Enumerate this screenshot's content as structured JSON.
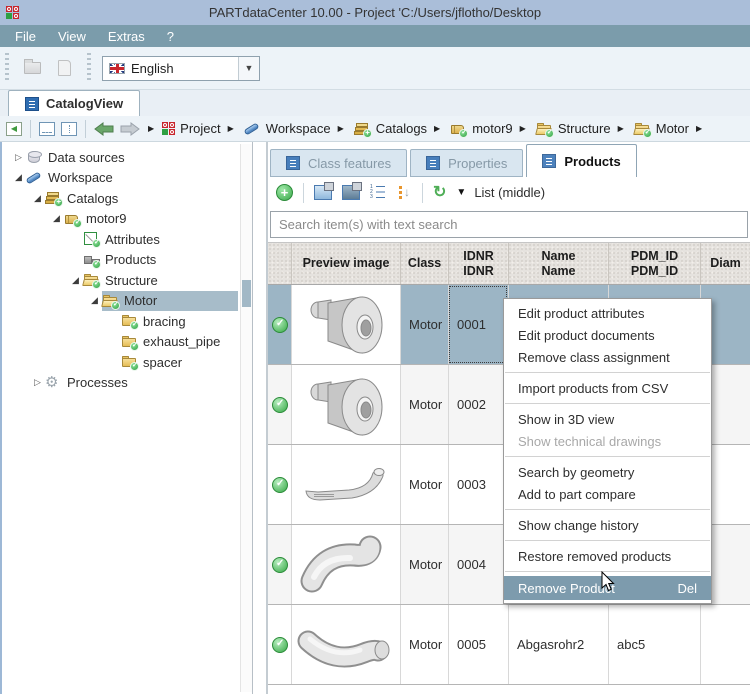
{
  "window": {
    "title": "PARTdataCenter 10.00 - Project 'C:/Users/jflotho/Desktop"
  },
  "menubar": {
    "items": [
      "File",
      "View",
      "Extras",
      "?"
    ]
  },
  "quick_toolbar": {
    "language_selector": {
      "value": "English",
      "flag": "uk-flag-icon"
    }
  },
  "view_tabs": {
    "catalog_view": "CatalogView"
  },
  "navbar": {
    "breadcrumb": [
      {
        "label": "Project",
        "icon": "project-logo-icon"
      },
      {
        "label": "Workspace",
        "icon": "workspace-icon"
      },
      {
        "label": "Catalogs",
        "icon": "catalogs-icon"
      },
      {
        "label": "motor9",
        "icon": "catalog-icon"
      },
      {
        "label": "Structure",
        "icon": "folder-open-icon"
      },
      {
        "label": "Motor",
        "icon": "folder-open-icon"
      }
    ]
  },
  "tree": {
    "items": [
      {
        "label": "Data sources",
        "icon": "database-icon",
        "state": "collapsed"
      },
      {
        "label": "Workspace",
        "icon": "workspace-icon",
        "state": "expanded"
      },
      {
        "label": "Catalogs",
        "icon": "catalogs-icon",
        "state": "expanded"
      },
      {
        "label": "motor9",
        "icon": "catalog-icon",
        "state": "expanded"
      },
      {
        "label": "Attributes",
        "icon": "attributes-icon",
        "state": "leaf"
      },
      {
        "label": "Products",
        "icon": "products-icon",
        "state": "leaf"
      },
      {
        "label": "Structure",
        "icon": "folder-open-icon",
        "state": "expanded"
      },
      {
        "label": "Motor",
        "icon": "folder-open-icon",
        "state": "expanded",
        "selected": true
      },
      {
        "label": "bracing",
        "icon": "folder-icon",
        "state": "leaf"
      },
      {
        "label": "exhaust_pipe",
        "icon": "folder-icon",
        "state": "leaf"
      },
      {
        "label": "spacer",
        "icon": "folder-icon",
        "state": "leaf"
      },
      {
        "label": "Processes",
        "icon": "gear-icon",
        "state": "collapsed"
      }
    ]
  },
  "panel": {
    "tabs": [
      {
        "label": "Class features",
        "active": false
      },
      {
        "label": "Properties",
        "active": false
      },
      {
        "label": "Products",
        "active": true
      }
    ],
    "toolbar": {
      "view_mode_label": "List (middle)"
    },
    "search": {
      "placeholder": "Search item(s) with text search"
    }
  },
  "table": {
    "columns": [
      {
        "line1": "",
        "line2": ""
      },
      {
        "line1": "Preview image",
        "line2": ""
      },
      {
        "line1": "Class",
        "line2": ""
      },
      {
        "line1": "IDNR",
        "line2": "IDNR"
      },
      {
        "line1": "Name",
        "line2": "Name"
      },
      {
        "line1": "PDM_ID",
        "line2": "PDM_ID"
      },
      {
        "line1": "",
        "line2": "Diam"
      }
    ],
    "rows": [
      {
        "status": "approved",
        "class": "Motor",
        "idnr": "0001",
        "name": "",
        "pdm_id": "",
        "preview": "motor-part"
      },
      {
        "status": "approved",
        "class": "Motor",
        "idnr": "0002",
        "name": "",
        "pdm_id": "",
        "preview": "motor-part"
      },
      {
        "status": "approved",
        "class": "Motor",
        "idnr": "0003",
        "name": "",
        "pdm_id": "",
        "preview": "curved-strap"
      },
      {
        "status": "approved",
        "class": "Motor",
        "idnr": "0004",
        "name": "",
        "pdm_id": "",
        "preview": "elbow-pipe"
      },
      {
        "status": "approved",
        "class": "Motor",
        "idnr": "0005",
        "name": "Abgasrohr2",
        "pdm_id": "abc5",
        "preview": "exhaust-pipe"
      }
    ]
  },
  "context_menu": {
    "items": [
      {
        "label": "Edit product attributes"
      },
      {
        "label": "Edit product documents"
      },
      {
        "label": "Remove class assignment"
      },
      {
        "label": "Import products from CSV"
      },
      {
        "label": "Show in 3D view"
      },
      {
        "label": "Show technical drawings",
        "disabled": true
      },
      {
        "label": "Search by geometry"
      },
      {
        "label": "Add to part compare"
      },
      {
        "label": "Show change history"
      },
      {
        "label": "Restore removed products"
      },
      {
        "label": "Remove Product",
        "shortcut": "Del",
        "highlighted": true
      }
    ]
  },
  "colors": {
    "titlebar": "#aabed9",
    "menubar": "#7b9cab",
    "row_selection": "#9cb5c5",
    "menu_highlight": "#7d9bad",
    "status_green": "#35a845"
  }
}
